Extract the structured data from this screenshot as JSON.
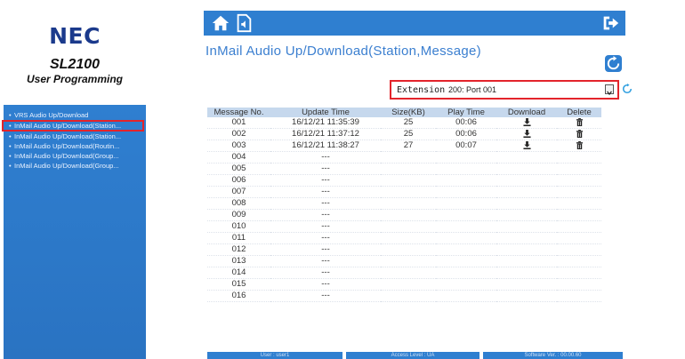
{
  "sidebar": {
    "logo": "NEC",
    "model": "SL2100",
    "subtitle": "User Programming",
    "items": [
      {
        "label": "VRS Audio Up/Download",
        "active": false
      },
      {
        "label": "InMail Audio Up/Download(Station...",
        "active": true
      },
      {
        "label": "InMail Audio Up/Download(Station...",
        "active": false
      },
      {
        "label": "InMail Audio Up/Download(Routin...",
        "active": false
      },
      {
        "label": "InMail Audio Up/Download(Group...",
        "active": false
      },
      {
        "label": "InMail Audio Up/Download(Group...",
        "active": false
      }
    ]
  },
  "topbar": {
    "icons": [
      "home-icon",
      "audio-file-icon",
      "logout-icon"
    ]
  },
  "page": {
    "title": "InMail Audio Up/Download(Station,Message)"
  },
  "extension": {
    "label": "Extension",
    "selected": "200: Port 001"
  },
  "table": {
    "headers": [
      "Message No.",
      "Update Time",
      "Size(KB)",
      "Play Time",
      "Download",
      "Delete"
    ],
    "rows": [
      [
        "001",
        "16/12/21 11:35:39",
        "25",
        "00:06",
        true
      ],
      [
        "002",
        "16/12/21 11:37:12",
        "25",
        "00:06",
        true
      ],
      [
        "003",
        "16/12/21 11:38:27",
        "27",
        "00:07",
        true
      ],
      [
        "004",
        "---",
        "",
        "",
        false
      ],
      [
        "005",
        "---",
        "",
        "",
        false
      ],
      [
        "006",
        "---",
        "",
        "",
        false
      ],
      [
        "007",
        "---",
        "",
        "",
        false
      ],
      [
        "008",
        "---",
        "",
        "",
        false
      ],
      [
        "009",
        "---",
        "",
        "",
        false
      ],
      [
        "010",
        "---",
        "",
        "",
        false
      ],
      [
        "011",
        "---",
        "",
        "",
        false
      ],
      [
        "012",
        "---",
        "",
        "",
        false
      ],
      [
        "013",
        "---",
        "",
        "",
        false
      ],
      [
        "014",
        "---",
        "",
        "",
        false
      ],
      [
        "015",
        "---",
        "",
        "",
        false
      ],
      [
        "016",
        "---",
        "",
        "",
        false
      ]
    ]
  },
  "footer": {
    "user": "User : user1",
    "access": "Access Level : UA",
    "software": "Software Ver. : 00.00.60"
  },
  "colors": {
    "primary": "#2f7fd0",
    "header_row": "#c6d8ed",
    "highlight": "#e3242b",
    "title_text": "#3b7fd0"
  }
}
